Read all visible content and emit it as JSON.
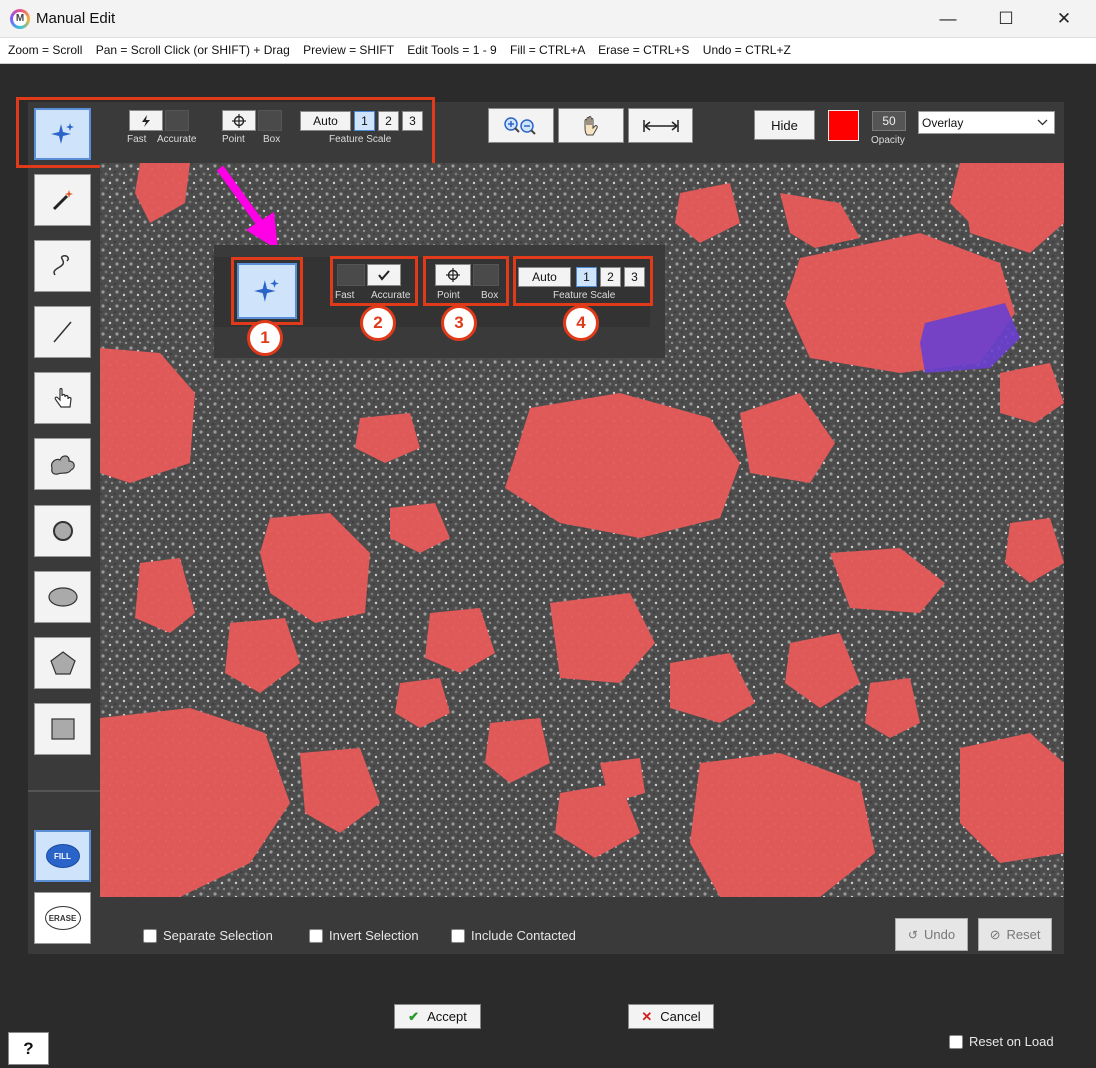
{
  "window": {
    "title": "Manual Edit",
    "minimize": "—",
    "maximize": "☐",
    "close": "✕"
  },
  "shortcuts": "Zoom = Scroll    Pan = Scroll Click (or SHIFT) + Drag    Preview = SHIFT    Edit Tools = 1 - 9    Fill = CTRL+A    Erase = CTRL+S    Undo = CTRL+Z",
  "toolbar": {
    "fast_label": "Fast",
    "accurate_label": "Accurate",
    "point_label": "Point",
    "box_label": "Box",
    "auto_label": "Auto",
    "scale_1": "1",
    "scale_2": "2",
    "scale_3": "3",
    "feature_scale_label": "Feature Scale",
    "hide_label": "Hide",
    "opacity_value": "50",
    "opacity_label": "Opacity",
    "overlay_value": "Overlay",
    "overlay_color": "#ff0000"
  },
  "callout": {
    "fast_label": "Fast",
    "accurate_label": "Accurate",
    "point_label": "Point",
    "box_label": "Box",
    "auto_label": "Auto",
    "scale_1": "1",
    "scale_2": "2",
    "scale_3": "3",
    "feature_scale_label": "Feature Scale",
    "numbers": [
      "1",
      "2",
      "3",
      "4"
    ]
  },
  "tools": [
    {
      "name": "smart-select-icon"
    },
    {
      "name": "magic-wand-icon"
    },
    {
      "name": "freehand-icon"
    },
    {
      "name": "line-icon"
    },
    {
      "name": "hand-pointer-icon"
    },
    {
      "name": "blob-icon"
    },
    {
      "name": "circle-brush-icon"
    },
    {
      "name": "ellipse-icon"
    },
    {
      "name": "polygon-icon"
    },
    {
      "name": "rectangle-icon"
    }
  ],
  "fill_label": "FILL",
  "erase_label": "ERASE",
  "options": {
    "separate_selection": "Separate Selection",
    "invert_selection": "Invert Selection",
    "include_contacted": "Include Contacted"
  },
  "undo_label": "Undo",
  "reset_label": "Reset",
  "accept_label": "Accept",
  "cancel_label": "Cancel",
  "reset_on_load_label": "Reset on Load",
  "help_label": "?",
  "colors": {
    "highlight_red": "#e03a1a",
    "arrow_magenta": "#ff00e6",
    "mask_red": "#e85a5a",
    "mask_purple": "#6a3fd0"
  }
}
